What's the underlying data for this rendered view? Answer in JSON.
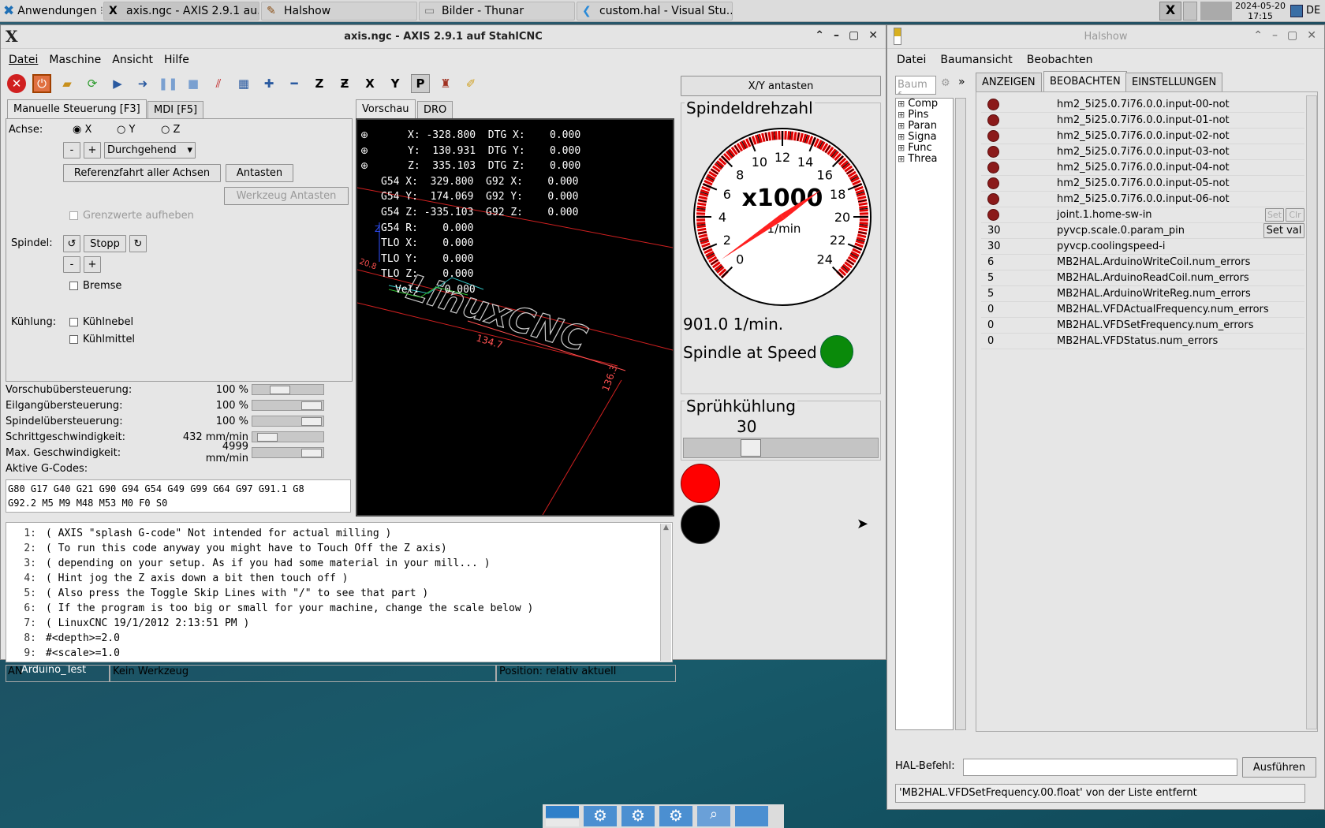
{
  "taskbar": {
    "start_label": "Anwendungen",
    "tasks": [
      {
        "label": "axis.ngc - AXIS 2.9.1 au..."
      },
      {
        "label": "Halshow"
      },
      {
        "label": "Bilder - Thunar"
      },
      {
        "label": "custom.hal - Visual Stu..."
      }
    ],
    "date": "2024-05-20",
    "time": "17:15",
    "kbd": "DE"
  },
  "axis": {
    "title": "axis.ngc - AXIS 2.9.1 auf StahlCNC",
    "menu": [
      "Datei",
      "Maschine",
      "Ansicht",
      "Hilfe"
    ],
    "tabs": [
      "Manuelle Steuerung [F3]",
      "MDI [F5]"
    ],
    "axis_label": "Achse:",
    "axis_options": [
      "X",
      "Y",
      "Z"
    ],
    "jog_mode": "Durchgehend",
    "home_all": "Referenzfahrt aller Achsen",
    "touch_off": "Antasten",
    "tool_touch_off": "Werkzeug Antasten",
    "override_limits": "Grenzwerte aufheben",
    "spindle_label": "Spindel:",
    "spindle_stop": "Stopp",
    "brake": "Bremse",
    "cooling_label": "Kühlung:",
    "mist": "Kühlnebel",
    "flood": "Kühlmittel",
    "overrides": [
      {
        "label": "Vorschubübersteuerung:",
        "value": "100 %",
        "level": 0.35
      },
      {
        "label": "Eilgangübersteuerung:",
        "value": "100 %",
        "level": 1.0
      },
      {
        "label": "Spindelübersteuerung:",
        "value": "100 %",
        "level": 1.0
      },
      {
        "label": "Schrittgeschwindigkeit:",
        "value": "432 mm/min",
        "level": 0.09
      },
      {
        "label": "Max. Geschwindigkeit:",
        "value": "4999 mm/min",
        "level": 1.0
      }
    ],
    "gcodes_label": "Aktive G-Codes:",
    "gcodes_line1": "G80 G17 G40 G21 G90 G94 G54 G49 G99 G64 G97 G91.1 G8",
    "gcodes_line2": "G92.2 M5 M9 M48 M53 M0 F0 S0",
    "preview_tabs": [
      "Vorschau",
      "DRO"
    ],
    "dro": [
      "X: -328.800  DTG X:    0.000",
      "Y:  130.931  DTG Y:    0.000",
      "Z:  335.103  DTG Z:    0.000",
      "G54 X:  329.800  G92 X:    0.000",
      "G54 Y:  174.069  G92 Y:    0.000",
      "G54 Z: -335.103  G92 Z:    0.000",
      "G54 R:    0.000",
      "TLO X:    0.000",
      "TLO Y:    0.000",
      "TLO Z:    0.000",
      "Vel:    0.000"
    ],
    "preview_text": "LinuxCNC",
    "dim1": "134.7",
    "dim2": "136.3",
    "dim3": "20.8",
    "gcode_lines": [
      {
        "n": "1:",
        "t": "( AXIS \"splash G-code\" Not intended for actual milling )"
      },
      {
        "n": "2:",
        "t": "( To run this code anyway you might have to Touch Off the Z axis)"
      },
      {
        "n": "3:",
        "t": "( depending on your setup. As if you had some material in your mill... )"
      },
      {
        "n": "4:",
        "t": "( Hint jog the Z axis down a bit then touch off )"
      },
      {
        "n": "5:",
        "t": "( Also press the Toggle Skip Lines with \"/\" to see that part )"
      },
      {
        "n": "6:",
        "t": "( If the program is too big or small for your machine, change the scale below )"
      },
      {
        "n": "7:",
        "t": "( LinuxCNC 19/1/2012 2:13:51 PM )"
      },
      {
        "n": "8:",
        "t": "#<depth>=2.0"
      },
      {
        "n": "9:",
        "t": "#<scale>=1.0"
      }
    ],
    "status": [
      "AN",
      "Kein Werkzeug",
      "Position: relativ aktuell"
    ],
    "pyvcp": {
      "probe_btn": "X/Y antasten",
      "spindle_title": "Spindeldrehzahl",
      "gauge_mult": "x1000",
      "gauge_unit": "1/min",
      "gauge_ticks": [
        "0",
        "2",
        "4",
        "6",
        "8",
        "10",
        "12",
        "14",
        "16",
        "18",
        "20",
        "22",
        "24"
      ],
      "gauge_value": 901.0,
      "speed_text": "901.0  1/min.",
      "at_speed": "Spindle at Speed",
      "cool_title": "Sprühkühlung",
      "cool_value": "30",
      "cool_level": 0.33,
      "led_red": "#ff0000",
      "led_black": "#000000",
      "led_green": "#008000"
    }
  },
  "halshow": {
    "title": "Halshow",
    "menu": [
      "Datei",
      "Baumansicht",
      "Beobachten"
    ],
    "search_placeholder": "Baum f",
    "tree": [
      "Comp",
      "Pins",
      "Paran",
      "Signa",
      "Func",
      "Threa"
    ],
    "tabs": [
      "ANZEIGEN",
      "BEOBACHTEN",
      "EINSTELLUNGEN"
    ],
    "watch": [
      {
        "val": "",
        "name": "hm2_5i25.0.7i76.0.0.input-00-not",
        "led": true
      },
      {
        "val": "",
        "name": "hm2_5i25.0.7i76.0.0.input-01-not",
        "led": true
      },
      {
        "val": "",
        "name": "hm2_5i25.0.7i76.0.0.input-02-not",
        "led": true
      },
      {
        "val": "",
        "name": "hm2_5i25.0.7i76.0.0.input-03-not",
        "led": true
      },
      {
        "val": "",
        "name": "hm2_5i25.0.7i76.0.0.input-04-not",
        "led": true
      },
      {
        "val": "",
        "name": "hm2_5i25.0.7i76.0.0.input-05-not",
        "led": true
      },
      {
        "val": "",
        "name": "hm2_5i25.0.7i76.0.0.input-06-not",
        "led": true
      },
      {
        "val": "",
        "name": "joint.1.home-sw-in",
        "led": true
      },
      {
        "val": "30",
        "name": "pyvcp.scale.0.param_pin",
        "led": false
      },
      {
        "val": "30",
        "name": "pyvcp.coolingspeed-i",
        "led": false
      },
      {
        "val": "6",
        "name": "MB2HAL.ArduinoWriteCoil.num_errors",
        "led": false
      },
      {
        "val": "5",
        "name": "MB2HAL.ArduinoReadCoil.num_errors",
        "led": false
      },
      {
        "val": "5",
        "name": "MB2HAL.ArduinoWriteReg.num_errors",
        "led": false
      },
      {
        "val": "0",
        "name": "MB2HAL.VFDActualFrequency.num_errors",
        "led": false
      },
      {
        "val": "0",
        "name": "MB2HAL.VFDSetFrequency.num_errors",
        "led": false
      },
      {
        "val": "0",
        "name": "MB2HAL.VFDStatus.num_errors",
        "led": false
      }
    ],
    "set_label": "Set",
    "clr_label": "Clr",
    "setval_label": "Set val",
    "cmd_label": "HAL-Befehl:",
    "run_label": "Ausführen",
    "message": "'MB2HAL.VFDSetFrequency.00.float' von der Liste entfernt"
  },
  "desktop": {
    "icon_label": "Arduino_Test"
  }
}
